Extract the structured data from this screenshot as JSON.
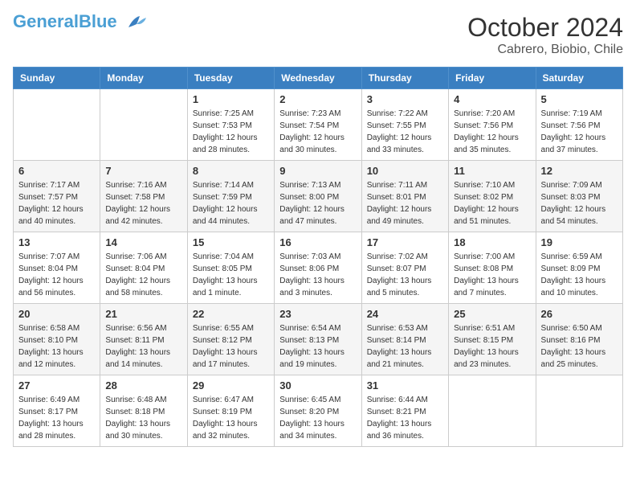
{
  "logo": {
    "general": "General",
    "blue": "Blue"
  },
  "header": {
    "month": "October 2024",
    "location": "Cabrero, Biobio, Chile"
  },
  "weekdays": [
    "Sunday",
    "Monday",
    "Tuesday",
    "Wednesday",
    "Thursday",
    "Friday",
    "Saturday"
  ],
  "weeks": [
    [
      {
        "day": "",
        "info": ""
      },
      {
        "day": "",
        "info": ""
      },
      {
        "day": "1",
        "info": "Sunrise: 7:25 AM\nSunset: 7:53 PM\nDaylight: 12 hours and 28 minutes."
      },
      {
        "day": "2",
        "info": "Sunrise: 7:23 AM\nSunset: 7:54 PM\nDaylight: 12 hours and 30 minutes."
      },
      {
        "day": "3",
        "info": "Sunrise: 7:22 AM\nSunset: 7:55 PM\nDaylight: 12 hours and 33 minutes."
      },
      {
        "day": "4",
        "info": "Sunrise: 7:20 AM\nSunset: 7:56 PM\nDaylight: 12 hours and 35 minutes."
      },
      {
        "day": "5",
        "info": "Sunrise: 7:19 AM\nSunset: 7:56 PM\nDaylight: 12 hours and 37 minutes."
      }
    ],
    [
      {
        "day": "6",
        "info": "Sunrise: 7:17 AM\nSunset: 7:57 PM\nDaylight: 12 hours and 40 minutes."
      },
      {
        "day": "7",
        "info": "Sunrise: 7:16 AM\nSunset: 7:58 PM\nDaylight: 12 hours and 42 minutes."
      },
      {
        "day": "8",
        "info": "Sunrise: 7:14 AM\nSunset: 7:59 PM\nDaylight: 12 hours and 44 minutes."
      },
      {
        "day": "9",
        "info": "Sunrise: 7:13 AM\nSunset: 8:00 PM\nDaylight: 12 hours and 47 minutes."
      },
      {
        "day": "10",
        "info": "Sunrise: 7:11 AM\nSunset: 8:01 PM\nDaylight: 12 hours and 49 minutes."
      },
      {
        "day": "11",
        "info": "Sunrise: 7:10 AM\nSunset: 8:02 PM\nDaylight: 12 hours and 51 minutes."
      },
      {
        "day": "12",
        "info": "Sunrise: 7:09 AM\nSunset: 8:03 PM\nDaylight: 12 hours and 54 minutes."
      }
    ],
    [
      {
        "day": "13",
        "info": "Sunrise: 7:07 AM\nSunset: 8:04 PM\nDaylight: 12 hours and 56 minutes."
      },
      {
        "day": "14",
        "info": "Sunrise: 7:06 AM\nSunset: 8:04 PM\nDaylight: 12 hours and 58 minutes."
      },
      {
        "day": "15",
        "info": "Sunrise: 7:04 AM\nSunset: 8:05 PM\nDaylight: 13 hours and 1 minute."
      },
      {
        "day": "16",
        "info": "Sunrise: 7:03 AM\nSunset: 8:06 PM\nDaylight: 13 hours and 3 minutes."
      },
      {
        "day": "17",
        "info": "Sunrise: 7:02 AM\nSunset: 8:07 PM\nDaylight: 13 hours and 5 minutes."
      },
      {
        "day": "18",
        "info": "Sunrise: 7:00 AM\nSunset: 8:08 PM\nDaylight: 13 hours and 7 minutes."
      },
      {
        "day": "19",
        "info": "Sunrise: 6:59 AM\nSunset: 8:09 PM\nDaylight: 13 hours and 10 minutes."
      }
    ],
    [
      {
        "day": "20",
        "info": "Sunrise: 6:58 AM\nSunset: 8:10 PM\nDaylight: 13 hours and 12 minutes."
      },
      {
        "day": "21",
        "info": "Sunrise: 6:56 AM\nSunset: 8:11 PM\nDaylight: 13 hours and 14 minutes."
      },
      {
        "day": "22",
        "info": "Sunrise: 6:55 AM\nSunset: 8:12 PM\nDaylight: 13 hours and 17 minutes."
      },
      {
        "day": "23",
        "info": "Sunrise: 6:54 AM\nSunset: 8:13 PM\nDaylight: 13 hours and 19 minutes."
      },
      {
        "day": "24",
        "info": "Sunrise: 6:53 AM\nSunset: 8:14 PM\nDaylight: 13 hours and 21 minutes."
      },
      {
        "day": "25",
        "info": "Sunrise: 6:51 AM\nSunset: 8:15 PM\nDaylight: 13 hours and 23 minutes."
      },
      {
        "day": "26",
        "info": "Sunrise: 6:50 AM\nSunset: 8:16 PM\nDaylight: 13 hours and 25 minutes."
      }
    ],
    [
      {
        "day": "27",
        "info": "Sunrise: 6:49 AM\nSunset: 8:17 PM\nDaylight: 13 hours and 28 minutes."
      },
      {
        "day": "28",
        "info": "Sunrise: 6:48 AM\nSunset: 8:18 PM\nDaylight: 13 hours and 30 minutes."
      },
      {
        "day": "29",
        "info": "Sunrise: 6:47 AM\nSunset: 8:19 PM\nDaylight: 13 hours and 32 minutes."
      },
      {
        "day": "30",
        "info": "Sunrise: 6:45 AM\nSunset: 8:20 PM\nDaylight: 13 hours and 34 minutes."
      },
      {
        "day": "31",
        "info": "Sunrise: 6:44 AM\nSunset: 8:21 PM\nDaylight: 13 hours and 36 minutes."
      },
      {
        "day": "",
        "info": ""
      },
      {
        "day": "",
        "info": ""
      }
    ]
  ]
}
